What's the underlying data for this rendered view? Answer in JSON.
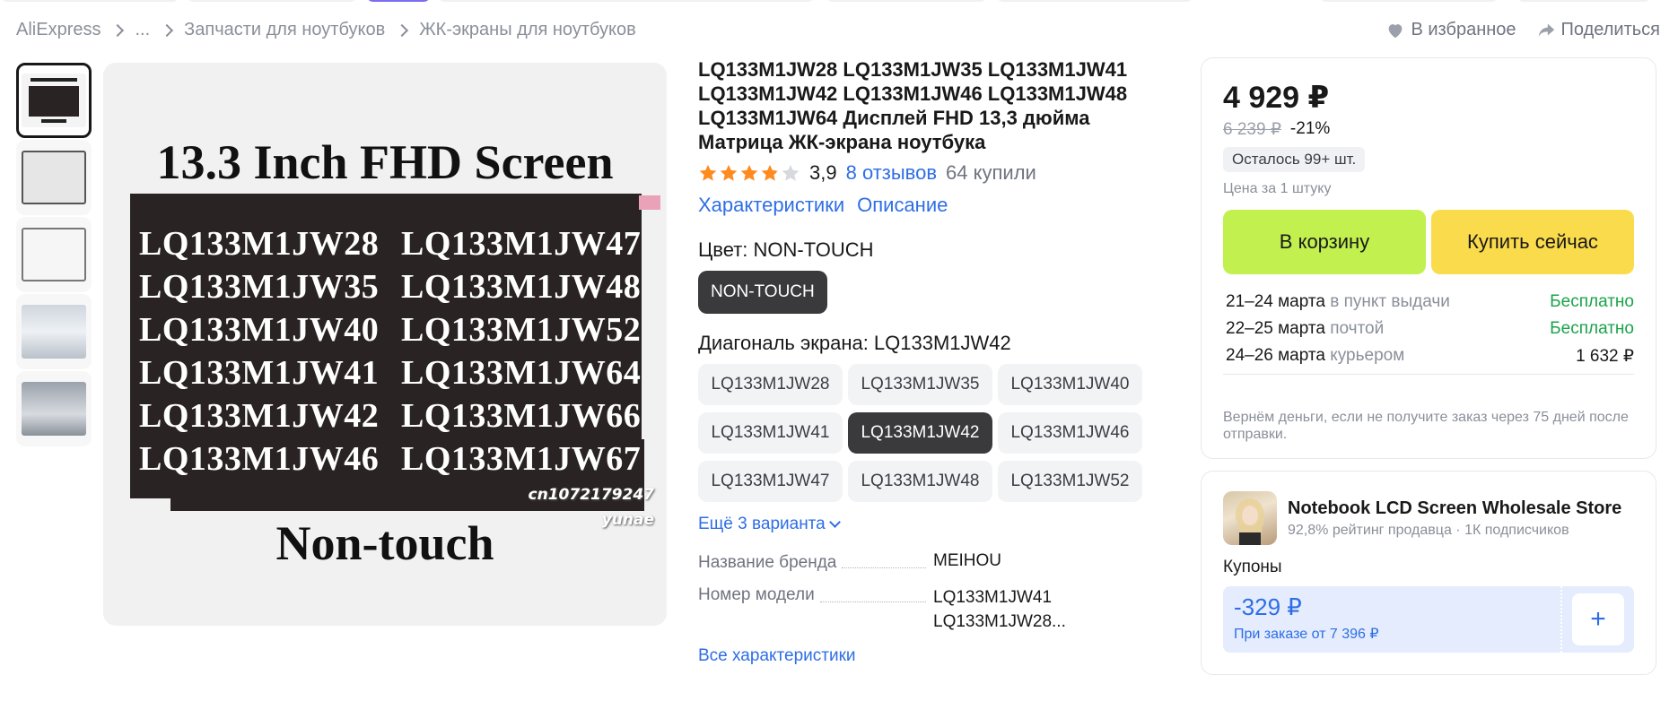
{
  "breadcrumbs": [
    "AliExpress",
    "...",
    "Запчасти для ноутбуков",
    "ЖК-экраны для ноутбуков"
  ],
  "top_actions": {
    "favorite": "В избранное",
    "share": "Поделиться"
  },
  "gallery": {
    "image_title": "13.3 Inch FHD Screen",
    "codes": [
      "LQ133M1JW28",
      "LQ133M1JW47",
      "LQ133M1JW35",
      "LQ133M1JW48",
      "LQ133M1JW40",
      "LQ133M1JW52",
      "LQ133M1JW41",
      "LQ133M1JW64",
      "LQ133M1JW42",
      "LQ133M1JW66",
      "LQ133M1JW46",
      "LQ133M1JW67"
    ],
    "watermark_1": "cn1072179247",
    "watermark_2": "yunae",
    "image_subtitle": "Non-touch",
    "thumb_count": 5
  },
  "product": {
    "title": "LQ133M1JW28 LQ133M1JW35 LQ133M1JW41 LQ133M1JW42 LQ133M1JW46 LQ133M1JW48 LQ133M1JW64 Дисплей FHD 13,3 дюйма Матрица ЖК-экрана ноутбука",
    "rating": "3,9",
    "rating_stars": 3.9,
    "reviews": "8 отзывов",
    "bought": "64 купили",
    "tab_specs": "Характеристики",
    "tab_desc": "Описание"
  },
  "color": {
    "label": "Цвет: NON-TOUCH",
    "option": "NON-TOUCH"
  },
  "diagonal": {
    "label": "Диагональ экрана: LQ133M1JW42",
    "options": [
      "LQ133M1JW28",
      "LQ133M1JW35",
      "LQ133M1JW40",
      "LQ133M1JW41",
      "LQ133M1JW42",
      "LQ133M1JW46",
      "LQ133M1JW47",
      "LQ133M1JW48",
      "LQ133M1JW52"
    ],
    "selected": "LQ133M1JW42",
    "more": "Ещё 3 варианта"
  },
  "specs": {
    "brand_key": "Название бренда",
    "brand_val": "MEIHOU",
    "model_key": "Номер модели",
    "model_val_1": "LQ133M1JW41",
    "model_val_2": "LQ133M1JW28...",
    "all_link": "Все характеристики"
  },
  "buy": {
    "price": "4 929 ₽",
    "old_price": "6 239 ₽",
    "discount": "-21%",
    "stock": "Осталось 99+ шт.",
    "unit_note": "Цена за 1 штуку",
    "cart_button": "В корзину",
    "buy_button": "Купить сейчас",
    "delivery": [
      {
        "date": "21–24 марта",
        "method": "в пункт выдачи",
        "price": "Бесплатно",
        "free": true
      },
      {
        "date": "22–25 марта",
        "method": "почтой",
        "price": "Бесплатно",
        "free": true
      },
      {
        "date": "24–26 марта",
        "method": "курьером",
        "price": "1 632 ₽",
        "free": false
      }
    ],
    "refund_note": "Вернём деньги, если не получите заказ через 75 дней после отправки."
  },
  "seller": {
    "name": "Notebook LCD Screen Wholesale Store",
    "rating": "92,8% рейтинг продавца",
    "followers": "1К подписчиков",
    "coupons_label": "Купоны",
    "coupon_value": "-329 ₽",
    "coupon_condition": "При заказе от 7 396 ₽",
    "coupon_add": "+"
  },
  "colors": {
    "link": "#2e6ee5",
    "cart": "#c2f04f",
    "buy": "#fadb4b",
    "free": "#1aa34a",
    "star": "#ff8a1f"
  }
}
